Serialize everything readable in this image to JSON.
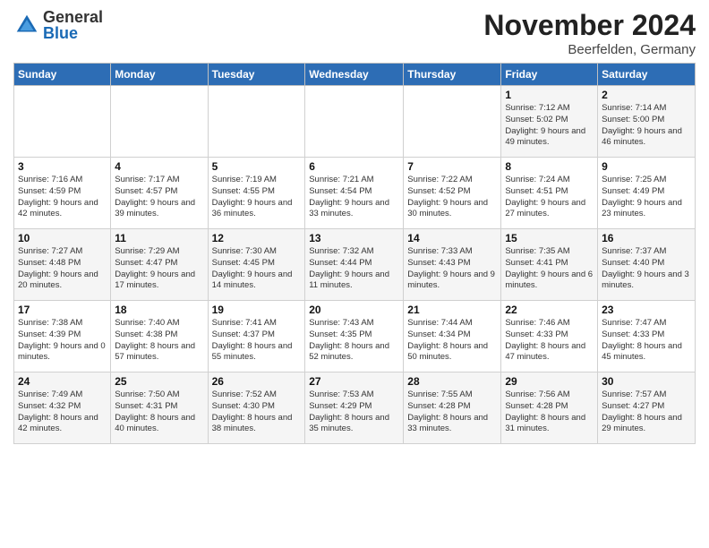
{
  "header": {
    "logo_general": "General",
    "logo_blue": "Blue",
    "title": "November 2024",
    "location": "Beerfelden, Germany"
  },
  "weekdays": [
    "Sunday",
    "Monday",
    "Tuesday",
    "Wednesday",
    "Thursday",
    "Friday",
    "Saturday"
  ],
  "weeks": [
    [
      {
        "day": "",
        "info": ""
      },
      {
        "day": "",
        "info": ""
      },
      {
        "day": "",
        "info": ""
      },
      {
        "day": "",
        "info": ""
      },
      {
        "day": "",
        "info": ""
      },
      {
        "day": "1",
        "info": "Sunrise: 7:12 AM\nSunset: 5:02 PM\nDaylight: 9 hours\nand 49 minutes."
      },
      {
        "day": "2",
        "info": "Sunrise: 7:14 AM\nSunset: 5:00 PM\nDaylight: 9 hours\nand 46 minutes."
      }
    ],
    [
      {
        "day": "3",
        "info": "Sunrise: 7:16 AM\nSunset: 4:59 PM\nDaylight: 9 hours\nand 42 minutes."
      },
      {
        "day": "4",
        "info": "Sunrise: 7:17 AM\nSunset: 4:57 PM\nDaylight: 9 hours\nand 39 minutes."
      },
      {
        "day": "5",
        "info": "Sunrise: 7:19 AM\nSunset: 4:55 PM\nDaylight: 9 hours\nand 36 minutes."
      },
      {
        "day": "6",
        "info": "Sunrise: 7:21 AM\nSunset: 4:54 PM\nDaylight: 9 hours\nand 33 minutes."
      },
      {
        "day": "7",
        "info": "Sunrise: 7:22 AM\nSunset: 4:52 PM\nDaylight: 9 hours\nand 30 minutes."
      },
      {
        "day": "8",
        "info": "Sunrise: 7:24 AM\nSunset: 4:51 PM\nDaylight: 9 hours\nand 27 minutes."
      },
      {
        "day": "9",
        "info": "Sunrise: 7:25 AM\nSunset: 4:49 PM\nDaylight: 9 hours\nand 23 minutes."
      }
    ],
    [
      {
        "day": "10",
        "info": "Sunrise: 7:27 AM\nSunset: 4:48 PM\nDaylight: 9 hours\nand 20 minutes."
      },
      {
        "day": "11",
        "info": "Sunrise: 7:29 AM\nSunset: 4:47 PM\nDaylight: 9 hours\nand 17 minutes."
      },
      {
        "day": "12",
        "info": "Sunrise: 7:30 AM\nSunset: 4:45 PM\nDaylight: 9 hours\nand 14 minutes."
      },
      {
        "day": "13",
        "info": "Sunrise: 7:32 AM\nSunset: 4:44 PM\nDaylight: 9 hours\nand 11 minutes."
      },
      {
        "day": "14",
        "info": "Sunrise: 7:33 AM\nSunset: 4:43 PM\nDaylight: 9 hours\nand 9 minutes."
      },
      {
        "day": "15",
        "info": "Sunrise: 7:35 AM\nSunset: 4:41 PM\nDaylight: 9 hours\nand 6 minutes."
      },
      {
        "day": "16",
        "info": "Sunrise: 7:37 AM\nSunset: 4:40 PM\nDaylight: 9 hours\nand 3 minutes."
      }
    ],
    [
      {
        "day": "17",
        "info": "Sunrise: 7:38 AM\nSunset: 4:39 PM\nDaylight: 9 hours\nand 0 minutes."
      },
      {
        "day": "18",
        "info": "Sunrise: 7:40 AM\nSunset: 4:38 PM\nDaylight: 8 hours\nand 57 minutes."
      },
      {
        "day": "19",
        "info": "Sunrise: 7:41 AM\nSunset: 4:37 PM\nDaylight: 8 hours\nand 55 minutes."
      },
      {
        "day": "20",
        "info": "Sunrise: 7:43 AM\nSunset: 4:35 PM\nDaylight: 8 hours\nand 52 minutes."
      },
      {
        "day": "21",
        "info": "Sunrise: 7:44 AM\nSunset: 4:34 PM\nDaylight: 8 hours\nand 50 minutes."
      },
      {
        "day": "22",
        "info": "Sunrise: 7:46 AM\nSunset: 4:33 PM\nDaylight: 8 hours\nand 47 minutes."
      },
      {
        "day": "23",
        "info": "Sunrise: 7:47 AM\nSunset: 4:33 PM\nDaylight: 8 hours\nand 45 minutes."
      }
    ],
    [
      {
        "day": "24",
        "info": "Sunrise: 7:49 AM\nSunset: 4:32 PM\nDaylight: 8 hours\nand 42 minutes."
      },
      {
        "day": "25",
        "info": "Sunrise: 7:50 AM\nSunset: 4:31 PM\nDaylight: 8 hours\nand 40 minutes."
      },
      {
        "day": "26",
        "info": "Sunrise: 7:52 AM\nSunset: 4:30 PM\nDaylight: 8 hours\nand 38 minutes."
      },
      {
        "day": "27",
        "info": "Sunrise: 7:53 AM\nSunset: 4:29 PM\nDaylight: 8 hours\nand 35 minutes."
      },
      {
        "day": "28",
        "info": "Sunrise: 7:55 AM\nSunset: 4:28 PM\nDaylight: 8 hours\nand 33 minutes."
      },
      {
        "day": "29",
        "info": "Sunrise: 7:56 AM\nSunset: 4:28 PM\nDaylight: 8 hours\nand 31 minutes."
      },
      {
        "day": "30",
        "info": "Sunrise: 7:57 AM\nSunset: 4:27 PM\nDaylight: 8 hours\nand 29 minutes."
      }
    ]
  ]
}
